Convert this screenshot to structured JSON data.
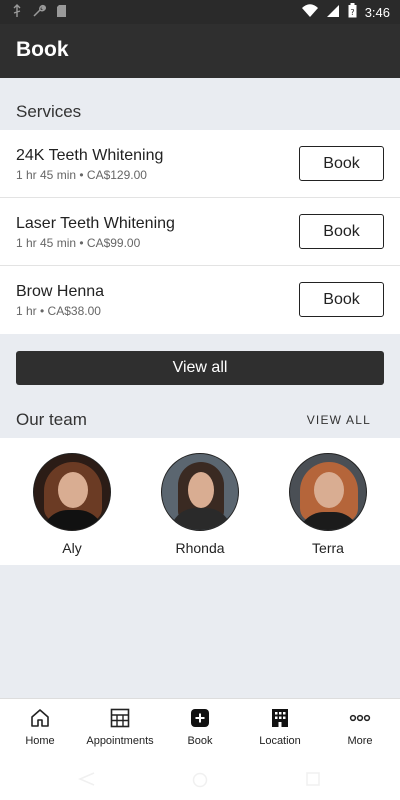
{
  "status_bar": {
    "time": "3:46"
  },
  "app_bar": {
    "title": "Book"
  },
  "services": {
    "heading": "Services",
    "items": [
      {
        "name": "24K Teeth Whitening",
        "meta": "1 hr 45 min • CA$129.00",
        "button": "Book"
      },
      {
        "name": "Laser Teeth Whitening",
        "meta": "1 hr 45 min • CA$99.00",
        "button": "Book"
      },
      {
        "name": "Brow Henna",
        "meta": "1 hr • CA$38.00",
        "button": "Book"
      }
    ],
    "view_all": "View all"
  },
  "team": {
    "heading": "Our team",
    "view_all": "VIEW ALL",
    "members": [
      {
        "name": "Aly"
      },
      {
        "name": "Rhonda"
      },
      {
        "name": "Terra"
      }
    ]
  },
  "bottom_nav": {
    "items": [
      {
        "label": "Home",
        "icon": "home-icon"
      },
      {
        "label": "Appointments",
        "icon": "calendar-grid-icon"
      },
      {
        "label": "Book",
        "icon": "plus-square-icon"
      },
      {
        "label": "Location",
        "icon": "building-icon"
      },
      {
        "label": "More",
        "icon": "more-dots-icon"
      }
    ]
  },
  "colors": {
    "app_bar": "#2f2f2f",
    "background": "#e9ecf1",
    "surface": "#ffffff",
    "primary_button": "#2f2f2f"
  }
}
